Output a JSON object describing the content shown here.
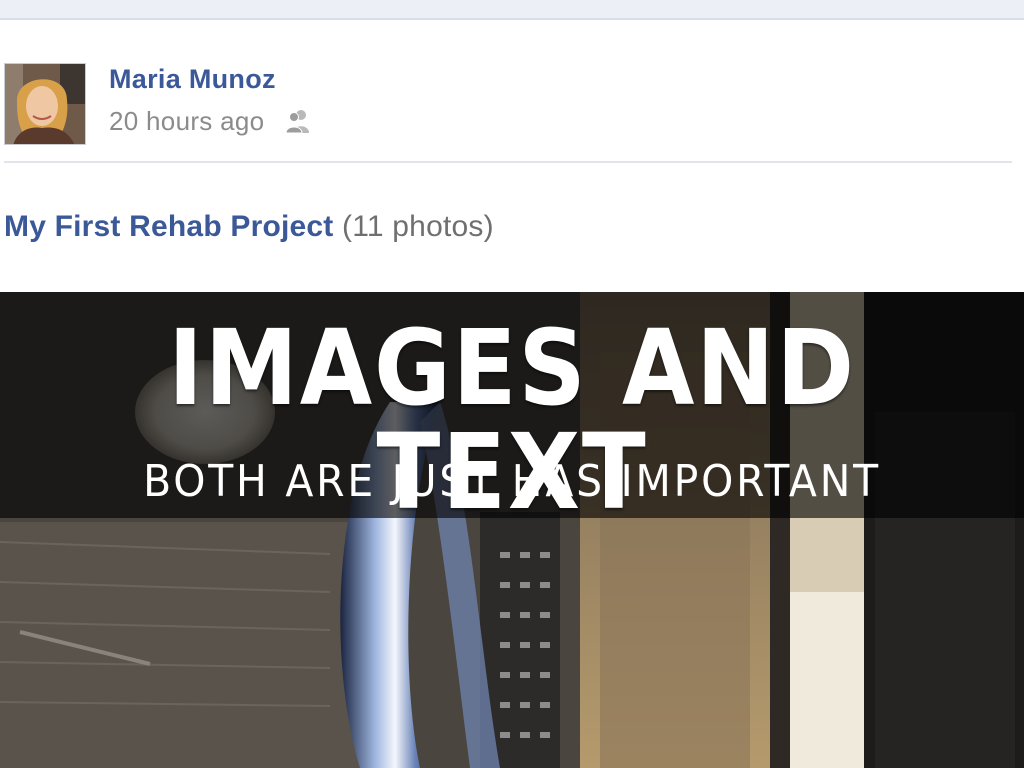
{
  "post": {
    "author": "Maria Munoz",
    "timestamp": "20 hours ago",
    "privacy_icon": "friends-icon",
    "album_title": "My First Rehab Project",
    "album_count": "(11 photos)"
  },
  "slide": {
    "headline": "IMAGES AND TEXT",
    "subline": "BOTH ARE JUST HAS IMPORTANT"
  },
  "colors": {
    "link_blue": "#3b5998",
    "timestamp_gray": "#8b8b8b",
    "banner_overlay": "#000000"
  }
}
